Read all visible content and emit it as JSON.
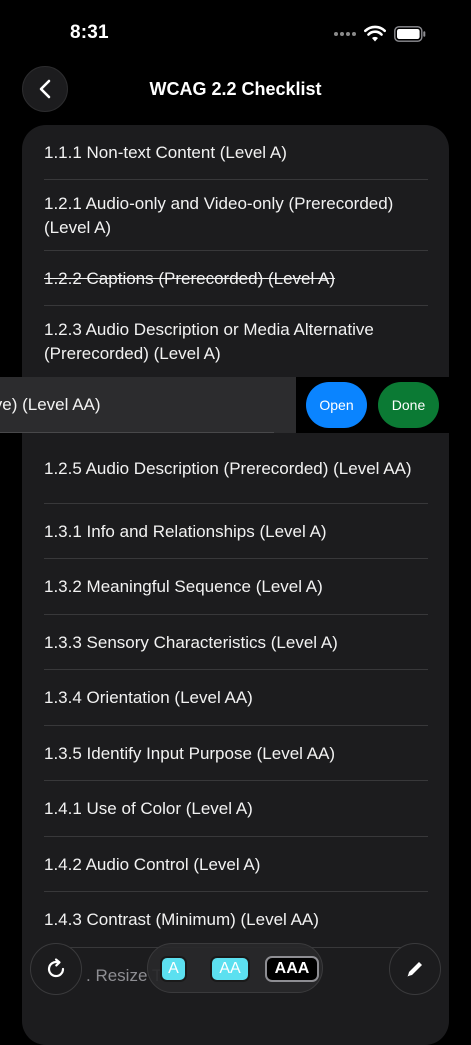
{
  "status": {
    "time": "8:31"
  },
  "nav": {
    "title": "WCAG 2.2 Checklist"
  },
  "items": [
    {
      "label": "1.1.1 Non-text Content (Level A)"
    },
    {
      "label": "1.2.1 Audio-only and Video-only (Prerecorded) (Level A)"
    },
    {
      "label": "1.2.2 Captions (Prerecorded) (Level A)",
      "done": true
    },
    {
      "label": "1.2.3 Audio Description or Media Alternative (Prerecorded) (Level A)"
    },
    {
      "label": "1.2.5 Audio Description (Prerecorded) (Level AA)"
    },
    {
      "label": "1.3.1 Info and Relationships (Level A)"
    },
    {
      "label": "1.3.2 Meaningful Sequence (Level A)"
    },
    {
      "label": "1.3.3 Sensory Characteristics (Level A)"
    },
    {
      "label": "1.3.4 Orientation (Level AA)"
    },
    {
      "label": "1.3.5 Identify Input Purpose (Level AA)"
    },
    {
      "label": "1.4.1 Use of Color (Level A)"
    },
    {
      "label": "1.4.2 Audio Control (Level A)"
    },
    {
      "label": "1.4.3 Contrast (Minimum) (Level AA)"
    }
  ],
  "swiped_item": {
    "visible_label": "ive) (Level AA)",
    "open_label": "Open",
    "done_label": "Done"
  },
  "partial_item": {
    "label": ". Resize T"
  },
  "level_filter": {
    "a_label": "A",
    "aa_label": "AA",
    "aaa_label": "AAA"
  },
  "colors": {
    "open": "#0a84ff",
    "done": "#0b7a34",
    "level_active": "#5ce0f0"
  }
}
